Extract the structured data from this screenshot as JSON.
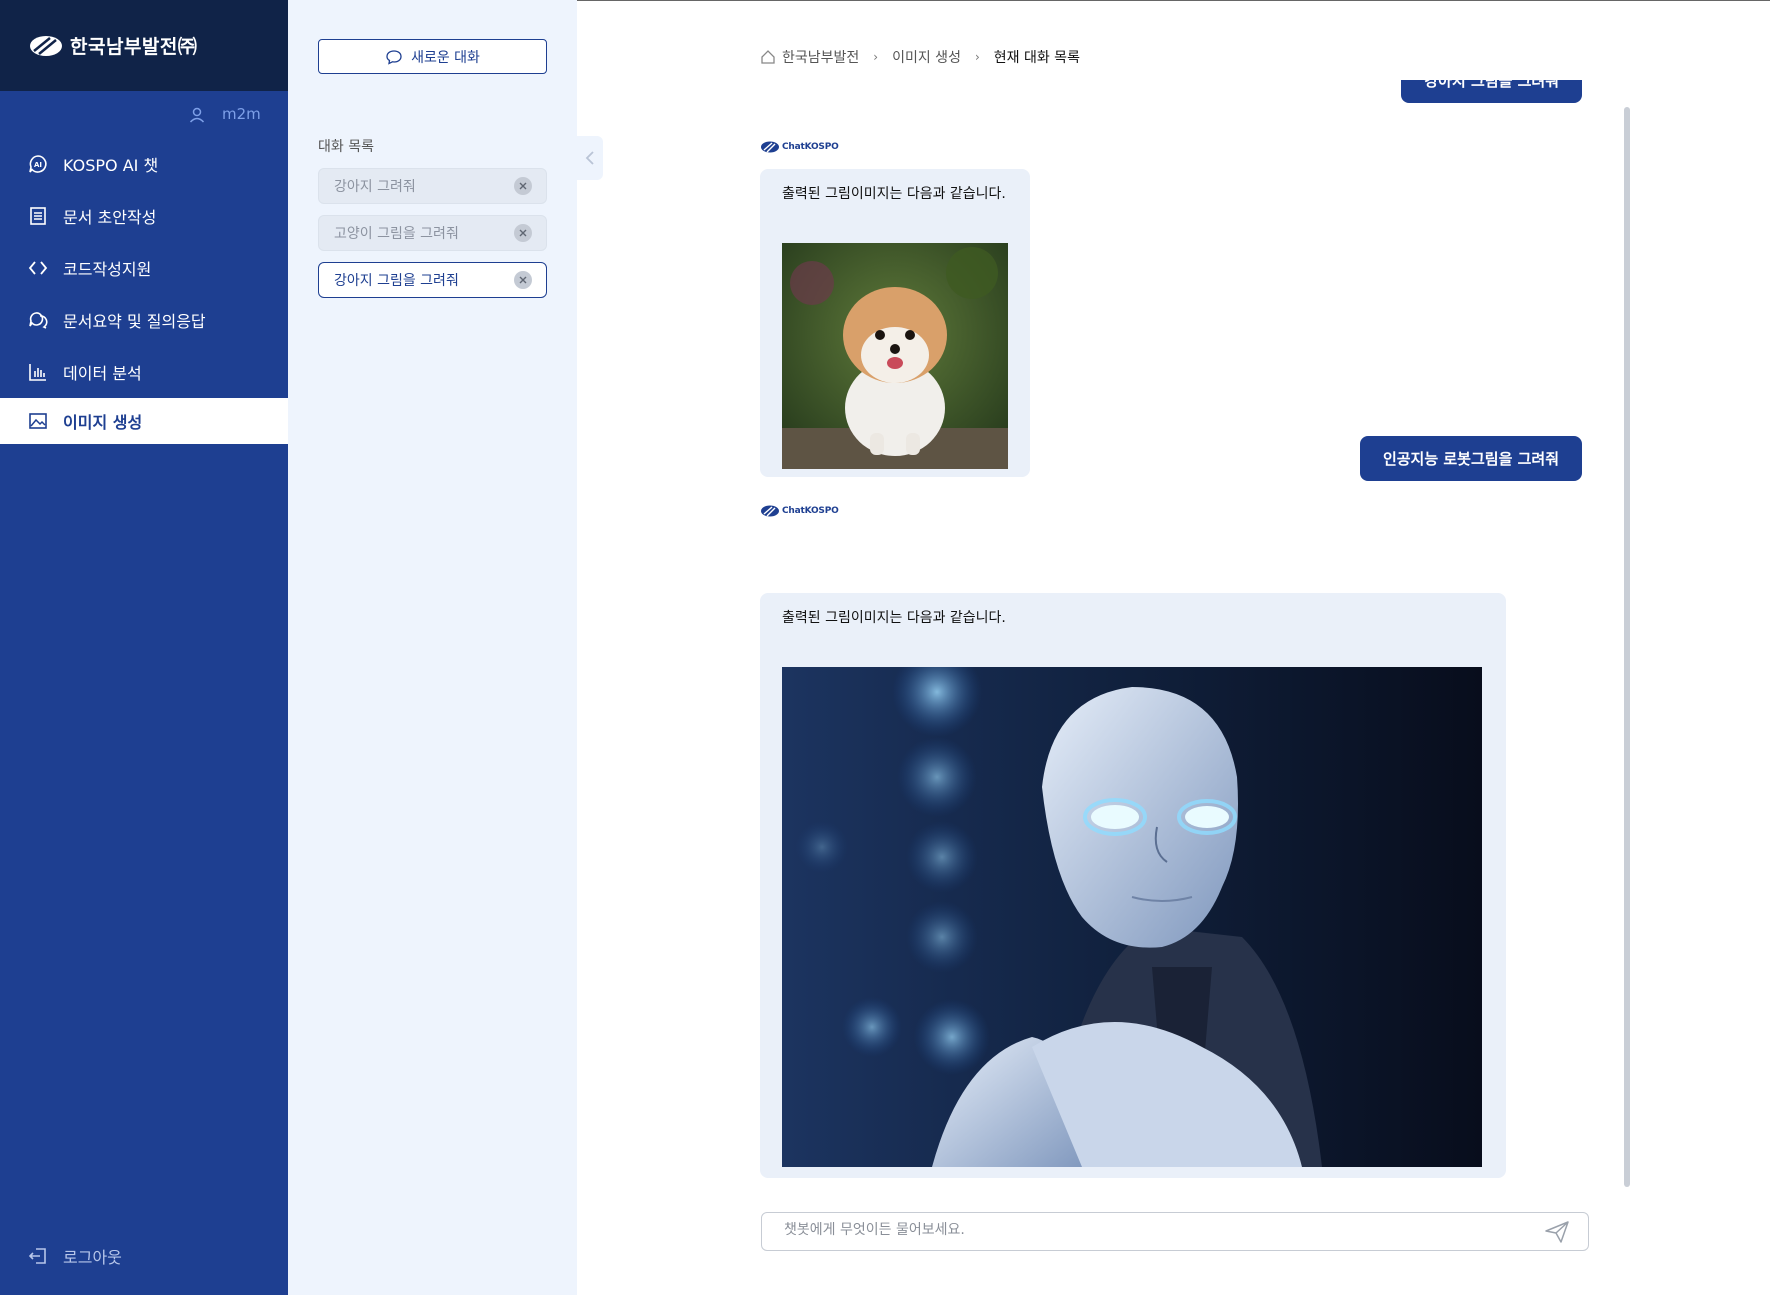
{
  "app": {
    "logo_text": "한국남부발전㈜",
    "user_name": "m2m"
  },
  "nav": {
    "items": [
      {
        "label": "KOSPO AI 챗",
        "icon": "ai-chat-icon"
      },
      {
        "label": "문서 초안작성",
        "icon": "document-icon"
      },
      {
        "label": "코드작성지원",
        "icon": "code-icon"
      },
      {
        "label": "문서요약 및 질의응답",
        "icon": "qa-icon"
      },
      {
        "label": "데이터 분석",
        "icon": "bar-chart-icon"
      },
      {
        "label": "이미지 생성",
        "icon": "image-icon",
        "active": true
      }
    ],
    "logout_label": "로그아웃"
  },
  "conversations": {
    "new_chat_label": "새로운 대화",
    "list_title": "대화 목록",
    "items": [
      {
        "label": "강아지 그려줘"
      },
      {
        "label": "고양이 그림을 그려줘"
      },
      {
        "label": "강아지 그림을 그려줘",
        "active": true
      }
    ]
  },
  "breadcrumb": {
    "home": "한국남부발전",
    "section": "이미지 생성",
    "current": "현재 대화 목록"
  },
  "messages": {
    "user_1": "강아지 그림을 그려줘",
    "bot_brand": "ChatKOSPO",
    "bot_1_text": "출력된 그림이미지는 다음과 같습니다.",
    "user_2": "인공지능 로봇그림을 그려줘",
    "bot_2_text": "출력된 그림이미지는 다음과 같습니다."
  },
  "input": {
    "placeholder": "챗봇에게 무엇이든 물어보세요."
  },
  "colors": {
    "primary": "#1e3f91",
    "nav_header": "#102348",
    "panel_bg": "#eef4fd",
    "bubble_bg": "#eaf0f9"
  }
}
